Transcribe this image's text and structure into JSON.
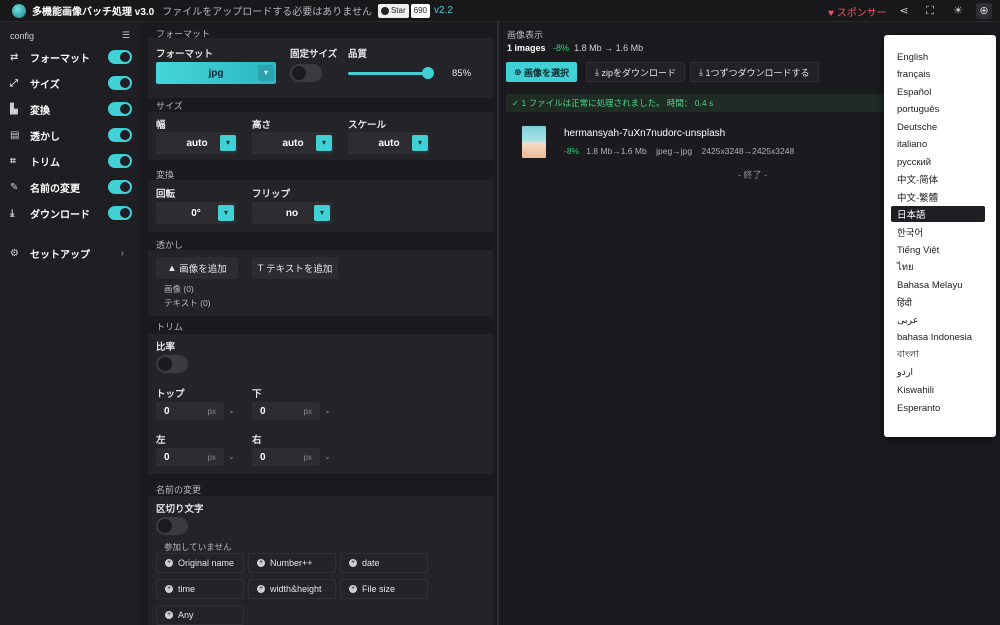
{
  "header": {
    "title": "多機能画像バッチ処理 v3.0",
    "subtitle": "ファイルをアップロードする必要はありません",
    "github_star_label": "Star",
    "github_star_count": "690",
    "version": "v2.2",
    "sponsor_label": "スポンサー",
    "icons": [
      "share-icon",
      "screenshot-icon",
      "sun-icon",
      "globe-icon"
    ]
  },
  "sidebar": {
    "header": "config",
    "items": [
      {
        "label": "フォーマット",
        "icon": "swap-icon",
        "enabled": true
      },
      {
        "label": "サイズ",
        "icon": "resize-icon",
        "enabled": true
      },
      {
        "label": "変換",
        "icon": "transform-icon",
        "enabled": true
      },
      {
        "label": "透かし",
        "icon": "watermark-icon",
        "enabled": true
      },
      {
        "label": "トリム",
        "icon": "crop-icon",
        "enabled": true
      },
      {
        "label": "名前の変更",
        "icon": "rename-icon",
        "enabled": true
      },
      {
        "label": "ダウンロード",
        "icon": "download-icon",
        "enabled": true
      }
    ],
    "setup_label": "セットアップ"
  },
  "config": {
    "format": {
      "section": "フォーマット",
      "format_label": "フォーマット",
      "format_value": "jpg",
      "fixed_size_label": "固定サイズ",
      "quality_label": "品質",
      "quality_value": "85%",
      "quality_fraction": 0.85
    },
    "size": {
      "section": "サイズ",
      "width_label": "幅",
      "width_value": "auto",
      "height_label": "高さ",
      "height_value": "auto",
      "scale_label": "スケール",
      "scale_value": "auto"
    },
    "transform": {
      "section": "変換",
      "rotate_label": "回転",
      "rotate_value": "0°",
      "flip_label": "フリップ",
      "flip_value": "no"
    },
    "watermark": {
      "section": "透かし",
      "add_image": "画像を追加",
      "add_text": "テキストを追加",
      "image_count": "画像 (0)",
      "text_count": "テキスト (0)"
    },
    "trim": {
      "section": "トリム",
      "ratio_label": "比率",
      "top_label": "トップ",
      "top_value": "0",
      "bottom_label": "下",
      "bottom_value": "0",
      "left_label": "左",
      "left_value": "0",
      "right_label": "右",
      "right_value": "0",
      "unit": "px"
    },
    "rename": {
      "section": "名前の変更",
      "separator_label": "区切り文字",
      "not_participating": "参加していません",
      "chips": [
        "Original name",
        "Number++",
        "date",
        "time",
        "width&height",
        "File size",
        "Any"
      ]
    }
  },
  "preview": {
    "title": "画像表示",
    "count": "1 images",
    "reduction": "-8%",
    "size_before": "1.8 Mb",
    "size_after": "1.6 Mb",
    "select_button": "画像を選択",
    "zip_button": "zipをダウンロード",
    "each_button": "1つずつダウンロードする",
    "success": "1 ファイルは正常に処理されました。 時間： 0.4 s",
    "file": {
      "name": "hermansyah-7uXn7nudorc-unsplash",
      "reduction": "-8%",
      "sizes": "1.8 Mb→1.6 Mb",
      "formats": "jpeg→jpg",
      "dims": "2425x3248→2425x3248"
    },
    "end": "- 終了 -"
  },
  "languages": {
    "items": [
      "English",
      "français",
      "Español",
      "português",
      "Deutsche",
      "italiano",
      "русский",
      "中文-简体",
      "中文-繁體",
      "日本語",
      "한국어",
      "Tiếng Việt",
      "ไทย",
      "Bahasa Melayu",
      "हिंदी",
      "عربى",
      "bahasa Indonesia",
      "বাংলা",
      "اردو",
      "Kiswahili",
      "Esperanto"
    ],
    "selected": "日本語"
  },
  "colors": {
    "accent": "#3fd1d6",
    "success": "#2fd07a",
    "sponsor": "#ff4d6d",
    "background": "#1b1b1f"
  }
}
